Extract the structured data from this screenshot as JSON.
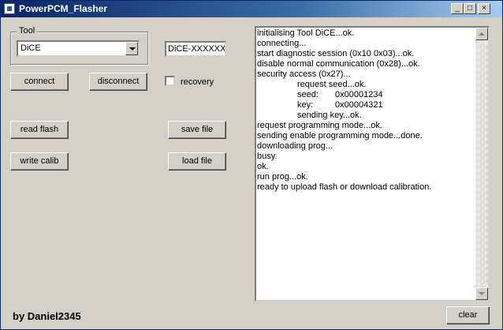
{
  "window": {
    "title": "PowerPCM_Flasher",
    "controls": {
      "minimize": "_",
      "maximize": "□",
      "close": "×"
    }
  },
  "tool_group": {
    "legend": "Tool",
    "tool_select": {
      "value": "DiCE"
    },
    "device_id": "DiCE-XXXXXX"
  },
  "buttons": {
    "connect": "connect",
    "disconnect": "disconnect",
    "read_flash": "read flash",
    "save_file": "save file",
    "write_calib": "write calib",
    "load_file": "load file",
    "clear": "clear"
  },
  "recovery": {
    "label": "recovery",
    "checked": false
  },
  "log": {
    "lines": [
      {
        "text": "initialising Tool DiCE...ok.",
        "indent": 0
      },
      {
        "text": "connecting...",
        "indent": 0
      },
      {
        "text": "start diagnostic session (0x10 0x03)...ok.",
        "indent": 0
      },
      {
        "text": "disable normal communication (0x28)...ok.",
        "indent": 0
      },
      {
        "text": "security access (0x27)...",
        "indent": 0
      },
      {
        "text": "request seed...ok.",
        "indent": 1
      },
      {
        "text": "seed:",
        "value": "0x00001234",
        "indent": 1
      },
      {
        "text": "key:",
        "value": "0x00004321",
        "indent": 1
      },
      {
        "text": "sending key...ok.",
        "indent": 1
      },
      {
        "text": "request programming mode...ok.",
        "indent": 0
      },
      {
        "text": "sending enable programming mode...done.",
        "indent": 0
      },
      {
        "text": "downloading prog...",
        "indent": 0
      },
      {
        "text": "busy.",
        "indent": 0
      },
      {
        "text": "ok.",
        "indent": 0
      },
      {
        "text": "run prog...ok.",
        "indent": 0
      },
      {
        "text": "ready to upload flash or download calibration.",
        "indent": 0
      }
    ]
  },
  "footer": {
    "credit": "by Daniel2345"
  },
  "colors": {
    "face": "#d4d0c8",
    "title_start": "#0a246a",
    "title_end": "#a6caf0"
  }
}
